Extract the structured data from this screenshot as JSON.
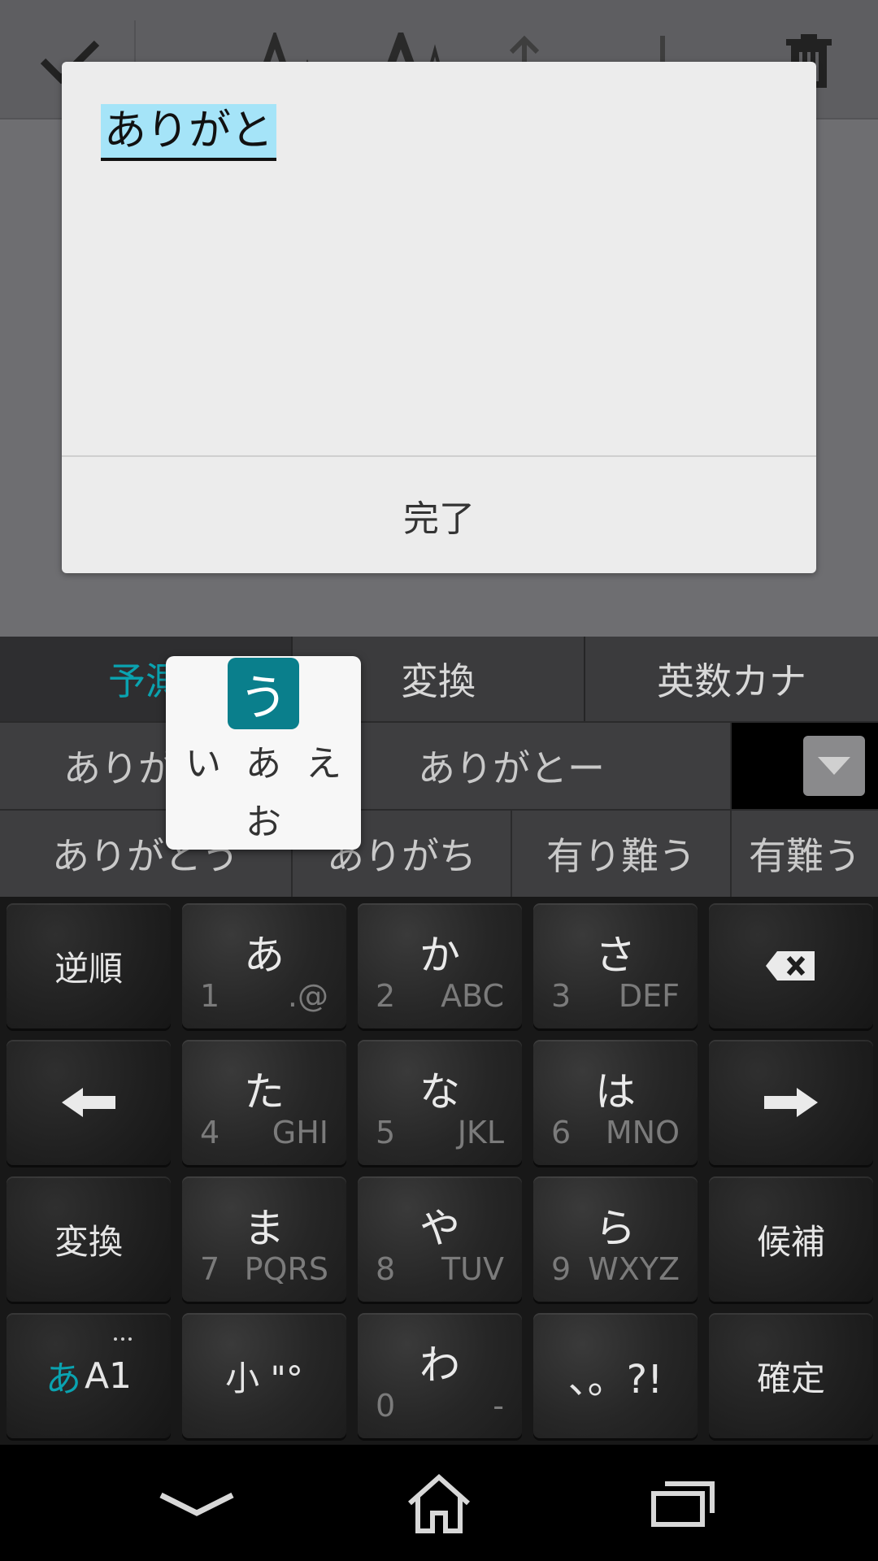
{
  "toolbar": {
    "icons": [
      "check-icon",
      "text-size-decrease-icon",
      "text-size-increase-icon",
      "move-up-icon",
      "move-down-icon",
      "trash-icon"
    ]
  },
  "dialog": {
    "input_text": "ありがと",
    "done_label": "完了"
  },
  "keyboard": {
    "modes": {
      "predict": "予測",
      "convert": "変換",
      "eisu_kana": "英数カナ"
    },
    "candidates_row1": [
      "ありが",
      "ありがとー"
    ],
    "candidates_row2": [
      "ありがとう",
      "ありがち",
      "有り難う",
      "有難う"
    ],
    "keys": {
      "r1": [
        {
          "main": "逆順"
        },
        {
          "main": "あ",
          "sub_l": "1",
          "sub_r": ".@"
        },
        {
          "main": "か",
          "sub_l": "2",
          "sub_r": "ABC"
        },
        {
          "main": "さ",
          "sub_l": "3",
          "sub_r": "DEF"
        },
        {
          "icon": "backspace-icon"
        }
      ],
      "r2": [
        {
          "icon": "arrow-left-icon"
        },
        {
          "main": "た",
          "sub_l": "4",
          "sub_r": "GHI"
        },
        {
          "main": "な",
          "sub_l": "5",
          "sub_r": "JKL"
        },
        {
          "main": "は",
          "sub_l": "6",
          "sub_r": "MNO"
        },
        {
          "icon": "arrow-right-icon"
        }
      ],
      "r3": [
        {
          "main": "変換"
        },
        {
          "main": "ま",
          "sub_l": "7",
          "sub_r": "PQRS"
        },
        {
          "main": "や",
          "sub_l": "8",
          "sub_r": "TUV"
        },
        {
          "main": "ら",
          "sub_l": "9",
          "sub_r": "WXYZ"
        },
        {
          "main": "候補"
        }
      ],
      "r4": [
        {
          "main_kana": "あ",
          "main_latin": "A1"
        },
        {
          "main": "小 \"°"
        },
        {
          "main": "わ",
          "sub_l": "0",
          "sub_r": "-"
        },
        {
          "main": "、。?!"
        },
        {
          "main": "確定"
        }
      ]
    },
    "popup": {
      "center": "う",
      "left": "い",
      "middle": "あ",
      "right": "え",
      "bottom": "お"
    }
  },
  "navbar": {
    "icons": [
      "back-chevron-icon",
      "home-icon",
      "recents-icon"
    ]
  },
  "colors": {
    "accent": "#0aa3b0",
    "popup_center": "#0a7f8c",
    "highlight": "#a5e4f8"
  }
}
